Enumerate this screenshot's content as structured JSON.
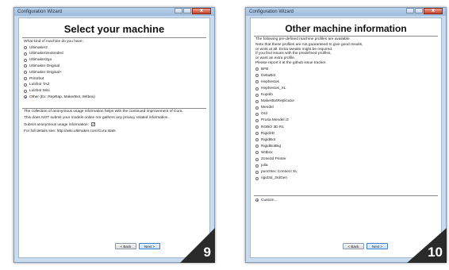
{
  "screen1": {
    "window_title": "Configuration Wizard",
    "close_glyph": "x",
    "heading": "Select your machine",
    "question": "What kind of machine do you have:",
    "options": [
      {
        "label": "Ultimaker2",
        "selected": false
      },
      {
        "label": "Ultimaker2extended",
        "selected": false
      },
      {
        "label": "Ultimaker2go",
        "selected": false
      },
      {
        "label": "Ultimaker Original",
        "selected": false
      },
      {
        "label": "Ultimaker Original+",
        "selected": false
      },
      {
        "label": "Printrbot",
        "selected": false
      },
      {
        "label": "Lulzbot TAZ",
        "selected": false
      },
      {
        "label": "Lulzbot Mini",
        "selected": false
      },
      {
        "label": "Other (Ex: RepRap, MakerBot, Witbox)",
        "selected": true
      }
    ],
    "usage_line1": "The collection of anonymous usage information helps with the continued improvement of Cura.",
    "usage_line2": "This does NOT submit your models online nor gathers any privacy related information.",
    "submit_label": "Submit anonymous usage information:",
    "submit_checked": true,
    "details_label": "For full details see: http://wiki.ultimaker.com/Cura:stats",
    "back_label": "< Back",
    "next_label": "Next >",
    "step_number": "9"
  },
  "screen2": {
    "window_title": "Configuration Wizard",
    "close_glyph": "x",
    "heading": "Other machine information",
    "intro": "The following pre-defined machine profiles are available",
    "notes": [
      "Note that these profiles are not guaranteed to give good results,",
      "or work at all. Extra tweaks might be required.",
      "If you find issues with the predefined profiles,",
      "or want an extra profile.",
      "Please report it at the github issue tracker."
    ],
    "profiles": [
      {
        "label": "BFB",
        "selected": false
      },
      {
        "label": "DeltaBot",
        "selected": false
      },
      {
        "label": "Hephestos",
        "selected": false
      },
      {
        "label": "Hephestos_XL",
        "selected": false
      },
      {
        "label": "Kupido",
        "selected": false
      },
      {
        "label": "MakerBotReplicator",
        "selected": false
      },
      {
        "label": "Mendel",
        "selected": false
      },
      {
        "label": "Ord",
        "selected": false
      },
      {
        "label": "Prusa Mendel i3",
        "selected": false
      },
      {
        "label": "ROBO 3D R1",
        "selected": false
      },
      {
        "label": "Rigid3D",
        "selected": false
      },
      {
        "label": "RigidBot",
        "selected": false
      },
      {
        "label": "RigidBotBig",
        "selected": false
      },
      {
        "label": "Witbox",
        "selected": false
      },
      {
        "label": "Zone3d Printer",
        "selected": false
      },
      {
        "label": "julia",
        "selected": false
      },
      {
        "label": "punchtec Connect XL",
        "selected": false
      },
      {
        "label": "rigid3d_3rdGen",
        "selected": false
      }
    ],
    "custom_label": "Custom...",
    "custom_selected": true,
    "back_label": "< Back",
    "next_label": "Next >",
    "step_number": "10"
  }
}
